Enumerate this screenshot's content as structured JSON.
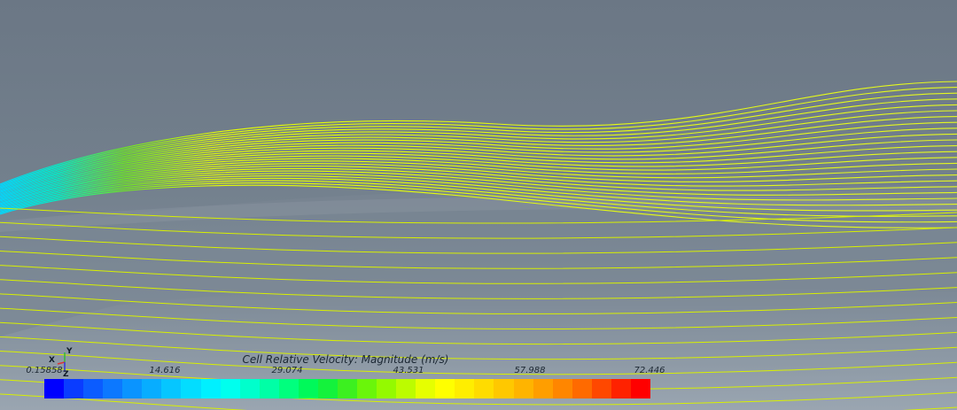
{
  "legend": {
    "title": "Cell Relative Velocity: Magnitude (m/s)",
    "ticks": [
      "0.15858",
      "14.616",
      "29.074",
      "43.531",
      "57.988",
      "72.446"
    ],
    "colors": [
      "#0000ff",
      "#0a3cff",
      "#0b5cff",
      "#0c78ff",
      "#0a94ff",
      "#08adff",
      "#06c6ff",
      "#03ddff",
      "#00f0ff",
      "#00ffee",
      "#00ffcc",
      "#00ffa6",
      "#00ff7e",
      "#00f95a",
      "#14f23c",
      "#3cf020",
      "#6af60a",
      "#94fa00",
      "#bcfc00",
      "#e6ff00",
      "#ffff00",
      "#ffee00",
      "#ffdc00",
      "#ffc800",
      "#ffb400",
      "#ff9e00",
      "#ff8600",
      "#ff6a00",
      "#ff4800",
      "#ff2200",
      "#ff0000"
    ]
  },
  "axes": {
    "x": "X",
    "y": "Y",
    "z": "Z"
  }
}
